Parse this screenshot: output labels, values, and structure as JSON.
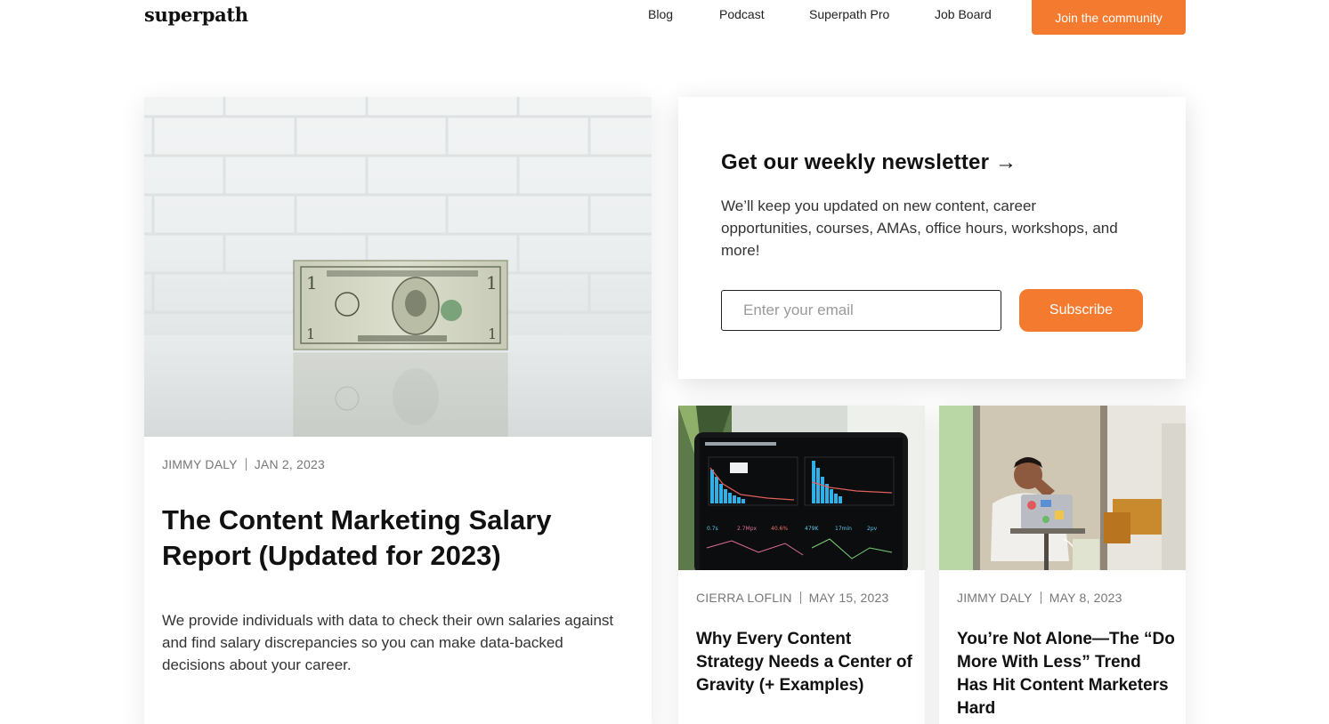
{
  "header": {
    "logo": "superpath",
    "nav": [
      {
        "label": "Blog"
      },
      {
        "label": "Podcast"
      },
      {
        "label": "Superpath Pro"
      },
      {
        "label": "Job Board"
      }
    ],
    "cta_label": "Join the community"
  },
  "featured": {
    "author": "JIMMY DALY",
    "date": "JAN 2, 2023",
    "title": "The Content Marketing Salary Report (Updated for 2023)",
    "description": "We provide individuals with data to check their own salaries against and find salary discrepancies so you can make data-backed decisions about your career.",
    "image_icon": "one-dollar-bill-photo"
  },
  "newsletter": {
    "title": "Get our weekly newsletter →",
    "description": "We’ll keep you updated on new content, career opportunities, courses, AMAs, office hours, workshops, and more!",
    "email_placeholder": "Enter your email",
    "email_value": "",
    "subscribe_label": "Subscribe"
  },
  "posts": [
    {
      "author": "CIERRA LOFLIN",
      "date": "MAY 15, 2023",
      "title": "Why Every Content Strategy Needs a Center of Gravity (+ Examples)",
      "image_icon": "analytics-dashboard-photo"
    },
    {
      "author": "JIMMY DALY",
      "date": "MAY 8, 2023",
      "title": "You’re Not Alone—The “Do More With Less” Trend Has Hit Content Marketers Hard",
      "image_icon": "stressed-man-laptop-photo"
    }
  ],
  "colors": {
    "accent": "#f47a2f",
    "text": "#111111",
    "muted": "#777777"
  }
}
